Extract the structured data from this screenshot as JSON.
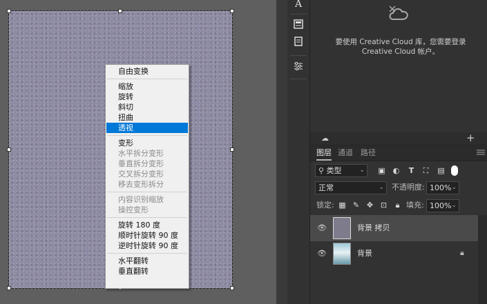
{
  "context_menu": {
    "groups": [
      [
        {
          "label": "自由变换",
          "disabled": false
        }
      ],
      [
        {
          "label": "缩放",
          "disabled": false
        },
        {
          "label": "旋转",
          "disabled": false
        },
        {
          "label": "斜切",
          "disabled": false
        },
        {
          "label": "扭曲",
          "disabled": false
        },
        {
          "label": "透视",
          "disabled": false,
          "selected": true
        }
      ],
      [
        {
          "label": "变形",
          "disabled": false
        },
        {
          "label": "水平拆分变形",
          "disabled": true
        },
        {
          "label": "垂直拆分变形",
          "disabled": true
        },
        {
          "label": "交叉拆分变形",
          "disabled": true
        },
        {
          "label": "移去变形拆分",
          "disabled": true
        }
      ],
      [
        {
          "label": "内容识别缩放",
          "disabled": true
        },
        {
          "label": "操控变形",
          "disabled": true
        }
      ],
      [
        {
          "label": "旋转 180 度",
          "disabled": false
        },
        {
          "label": "顺时针旋转 90 度",
          "disabled": false
        },
        {
          "label": "逆时针旋转 90 度",
          "disabled": false
        }
      ],
      [
        {
          "label": "水平翻转",
          "disabled": false
        },
        {
          "label": "垂直翻转",
          "disabled": false
        }
      ]
    ]
  },
  "cc_panel": {
    "message": "要使用 Creative Cloud 库，您需要登录 Creative Cloud 帐户。"
  },
  "layers_panel": {
    "tabs": [
      "图层",
      "通道",
      "路径"
    ],
    "active_tab": 0,
    "filter_label": "类型",
    "blend_mode": "正常",
    "opacity_label": "不透明度:",
    "opacity_value": "100%",
    "lock_label": "锁定:",
    "fill_label": "填充:",
    "fill_value": "100%",
    "layers": [
      {
        "name": "背景 拷贝",
        "selected": true,
        "locked": false
      },
      {
        "name": "背景",
        "selected": false,
        "locked": true
      }
    ]
  },
  "colors": {
    "selection": "#0078d7",
    "panel_bg": "#323232",
    "canvas_bg": "#5f5f5f"
  }
}
